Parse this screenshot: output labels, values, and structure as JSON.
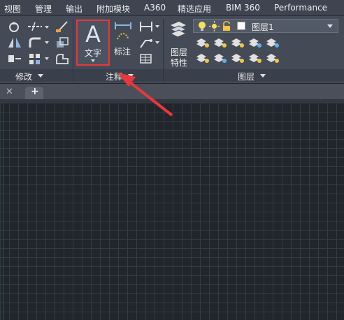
{
  "menu_tabs": [
    "视图",
    "管理",
    "输出",
    "附加模块",
    "A360",
    "精选应用",
    "BIM 360",
    "Performance"
  ],
  "panels": {
    "modify": "修改",
    "annotation": "注释",
    "layers": "图层"
  },
  "annotation": {
    "text_button": "文字",
    "text_icon": "A",
    "dimension_button": "标注"
  },
  "layers": {
    "layer_properties_line1": "图层",
    "layer_properties_line2": "特性",
    "current_layer": "图层1"
  },
  "colors": {
    "highlight": "#e8383d",
    "arrow": "#e8383d",
    "ribbon": "#444b57",
    "canvas": "#21252c"
  },
  "icons": [
    "move-icon",
    "trim-icon",
    "erase-icon",
    "mirror-icon",
    "fillet-icon",
    "scale-icon",
    "array-icon",
    "offset-icon",
    "linear-dim-icon",
    "leader-icon",
    "table-icon",
    "layer-stack-icon",
    "bulb-icon",
    "sun-icon",
    "lock-icon"
  ]
}
